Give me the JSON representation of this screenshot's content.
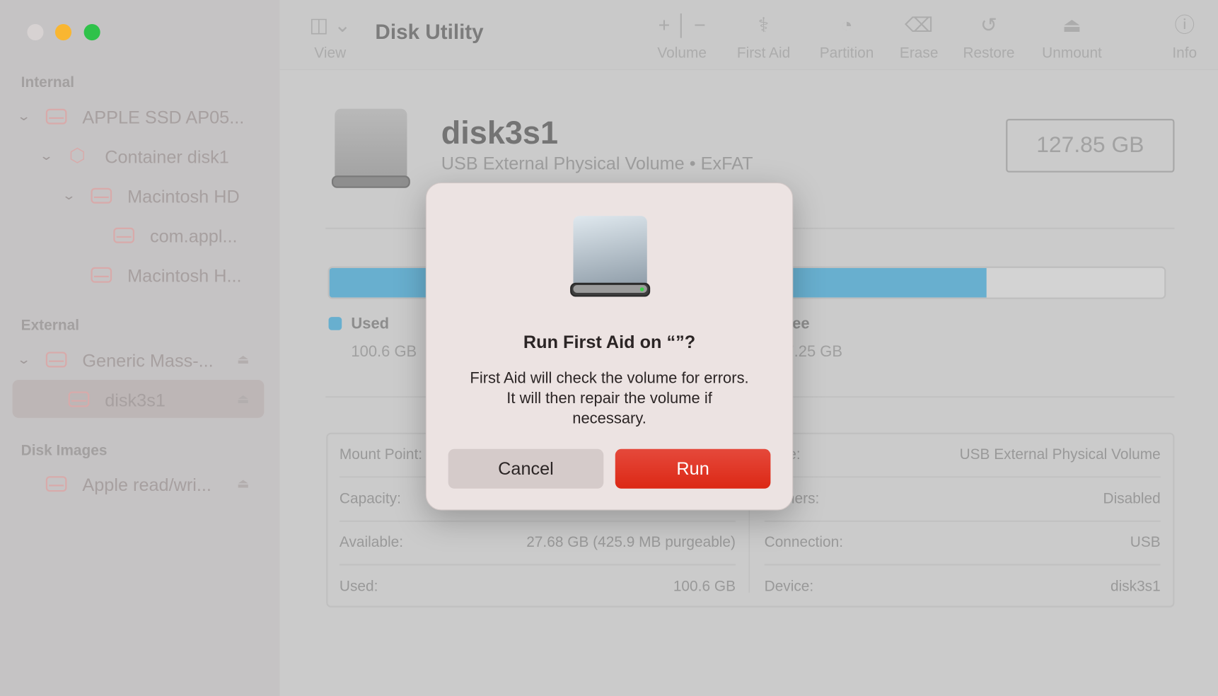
{
  "window": {
    "title": "Disk Utility",
    "traffic_lights": [
      "#d7d2d2",
      "#f9b631",
      "#2fc24a"
    ]
  },
  "sidebar": {
    "sections": [
      "Internal",
      "External",
      "Disk Images"
    ],
    "items": [
      {
        "label": "APPLE SSD AP05..."
      },
      {
        "label": "Container disk1"
      },
      {
        "label": "Macintosh HD"
      },
      {
        "label": "com.appl..."
      },
      {
        "label": "Macintosh H..."
      },
      {
        "label": "Generic Mass-..."
      },
      {
        "label": "disk3s1",
        "selected": true
      },
      {
        "label": "Apple read/wri..."
      }
    ]
  },
  "toolbar": {
    "view": "View",
    "volume": "Volume",
    "first_aid": "First Aid",
    "partition": "Partition",
    "erase": "Erase",
    "restore": "Restore",
    "unmount": "Unmount",
    "info": "Info"
  },
  "volume": {
    "name": "disk3s1",
    "subtitle": "USB External Physical Volume • ExFAT",
    "size": "127.85 GB",
    "usage": {
      "used_fraction": 0.787,
      "used_color": "#68afcf",
      "used_label": "Used",
      "used_value": "100.6 GB",
      "free_label": "Free",
      "free_value": "27.25 GB"
    }
  },
  "info": {
    "left": [
      {
        "label": "Mount Point:",
        "value": ""
      },
      {
        "label": "Capacity:",
        "value": ""
      },
      {
        "label": "Available:",
        "value": "27.68 GB (425.9 MB purgeable)"
      },
      {
        "label": "Used:",
        "value": "100.6 GB"
      }
    ],
    "right": [
      {
        "label": "Type:",
        "value": "USB External Physical Volume"
      },
      {
        "label": "Owners:",
        "value": "Disabled"
      },
      {
        "label": "Connection:",
        "value": "USB"
      },
      {
        "label": "Device:",
        "value": "disk3s1"
      }
    ]
  },
  "dialog": {
    "title": "Run First Aid on “”?",
    "line1": "First Aid will check the volume for errors.",
    "line2": "It will then repair the volume if",
    "line3": "necessary.",
    "cancel": "Cancel",
    "run": "Run",
    "run_color": "#e0321f"
  }
}
